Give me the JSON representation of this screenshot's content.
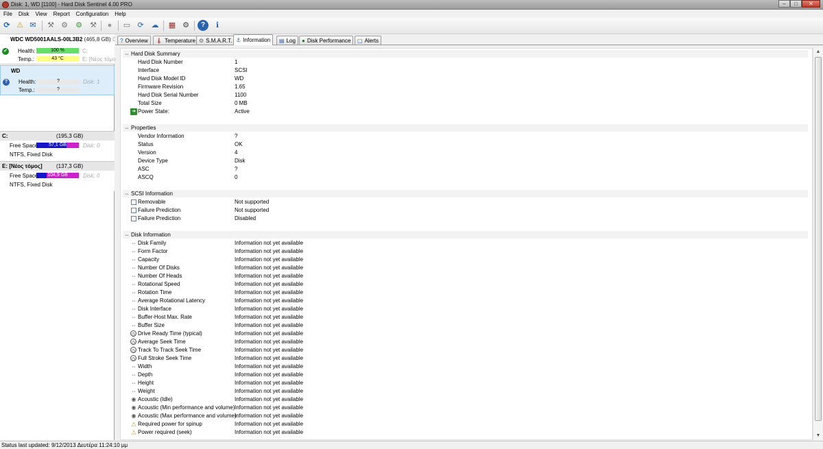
{
  "window": {
    "title": "Disk: 1, WD [1100]  -  Hard Disk Sentinel 4.00 PRO",
    "controls": {
      "minimize": "–",
      "maximize": "□",
      "close": "✕"
    }
  },
  "menu": [
    "File",
    "Disk",
    "View",
    "Report",
    "Configuration",
    "Help"
  ],
  "toolbar": {
    "icons": [
      "refresh-icon",
      "alert-icon",
      "mail-icon",
      "report-icon",
      "test-icon",
      "wrench-icon",
      "speed-icon",
      "short-test-icon",
      "disk-test-icon",
      "copy-icon",
      "clipboard-icon",
      "settings-icon",
      "hardware-icon",
      "help-icon",
      "info-icon"
    ],
    "glyphs": {
      "refresh": "⟳",
      "alert": "⚠",
      "mail": "✉",
      "t1": "⚒",
      "t2": "⚙",
      "t3": "⚙",
      "t4": "⚒",
      "t5": "●",
      "t6": "▭",
      "t7": "⟳",
      "t8": "☁",
      "t9": "▦",
      "t10": "⚙",
      "help": "?",
      "info": "ℹ"
    }
  },
  "disks": [
    {
      "name": "WDC WD5001AALS-00L3B2",
      "size": "(465,8 GB)",
      "extra": "Disk",
      "status": "✔",
      "health_label": "Health:",
      "health": "100 %",
      "health_pct": 100,
      "health_color": "#66dd66",
      "temp_label": "Temp.:",
      "temp": "43 °C",
      "temp_color": "#ffff88",
      "vol1": "C:",
      "vol2": "E: [Νέος τόμο"
    },
    {
      "name": "WD",
      "status": "?",
      "health_label": "Health:",
      "health": "?",
      "temp_label": "Temp.:",
      "temp": "?",
      "disk_ref": "Disk: 1"
    }
  ],
  "volumes": [
    {
      "letter": "C:",
      "size": "(195,3 GB)",
      "free_label": "Free Space",
      "free": "57,1 GB",
      "used_pct": 71,
      "disk_ref": "Disk: 0",
      "fs": "NTFS, Fixed Disk"
    },
    {
      "letter": "E: [Νέος τόμος]",
      "size": "(137,3 GB)",
      "free_label": "Free Space",
      "free": "104,9 GB",
      "used_pct": 24,
      "disk_ref": "Disk: 0",
      "fs": "NTFS, Fixed Disk"
    }
  ],
  "tabs": [
    {
      "label": "Overview",
      "icon": "?"
    },
    {
      "label": "Temperature",
      "icon": "🌡"
    },
    {
      "label": "S.M.A.R.T.",
      "icon": "⚙"
    },
    {
      "label": "Information",
      "icon": "⚓"
    },
    {
      "label": "Log",
      "icon": "▤"
    },
    {
      "label": "Disk Performance",
      "icon": "●"
    },
    {
      "label": "Alerts",
      "icon": "▢"
    }
  ],
  "sections": {
    "summary": {
      "title": "Hard Disk Summary",
      "rows": [
        {
          "label": "Hard Disk Number",
          "value": "1"
        },
        {
          "label": "Interface",
          "value": "SCSI"
        },
        {
          "label": "Hard Disk Model ID",
          "value": "WD"
        },
        {
          "label": "Firmware Revision",
          "value": "1.65"
        },
        {
          "label": "Hard Disk Serial Number",
          "value": "1100"
        },
        {
          "label": "Total Size",
          "value": "0 MB"
        },
        {
          "label": "Power State:",
          "value": "Active"
        }
      ]
    },
    "properties": {
      "title": "Properties",
      "rows": [
        {
          "label": "Vendor Information",
          "value": "?"
        },
        {
          "label": "Status",
          "value": "OK"
        },
        {
          "label": "Version",
          "value": "4"
        },
        {
          "label": "Device Type",
          "value": "Disk"
        },
        {
          "label": "ASC",
          "value": "?"
        },
        {
          "label": "ASCQ",
          "value": "0"
        }
      ]
    },
    "scsi": {
      "title": "SCSI Information",
      "rows": [
        {
          "label": "Removable",
          "value": "Not supported"
        },
        {
          "label": "Failure Prediction",
          "value": "Not supported"
        },
        {
          "label": "Failure Prediction",
          "value": "Disabled"
        }
      ]
    },
    "disk_info": {
      "title": "Disk Information",
      "na": "Information not yet available",
      "rows": [
        {
          "label": "Disk Family",
          "value": "Information not yet available"
        },
        {
          "label": "Form Factor",
          "value": "Information not yet available"
        },
        {
          "label": "Capacity",
          "value": "Information not yet available"
        },
        {
          "label": "Number Of Disks",
          "value": "Information not yet available"
        },
        {
          "label": "Number Of Heads",
          "value": "Information not yet available"
        },
        {
          "label": "Rotational Speed",
          "value": "Information not yet available"
        },
        {
          "label": "Rotation Time",
          "value": "Information not yet available"
        },
        {
          "label": "Average Rotational Latency",
          "value": "Information not yet available"
        },
        {
          "label": "Disk Interface",
          "value": "Information not yet available"
        },
        {
          "label": "Buffer-Host Max. Rate",
          "value": "Information not yet available"
        },
        {
          "label": "Buffer Size",
          "value": "Information not yet available"
        },
        {
          "label": "Drive Ready Time (typical)",
          "value": "Information not yet available"
        },
        {
          "label": "Average Seek Time",
          "value": "Information not yet available"
        },
        {
          "label": "Track To Track Seek Time",
          "value": "Information not yet available"
        },
        {
          "label": "Full Stroke Seek Time",
          "value": "Information not yet available"
        },
        {
          "label": "Width",
          "value": "Information not yet available"
        },
        {
          "label": "Depth",
          "value": "Information not yet available"
        },
        {
          "label": "Height",
          "value": "Information not yet available"
        },
        {
          "label": "Weight",
          "value": "Information not yet available"
        },
        {
          "label": "Acoustic (Idle)",
          "value": "Information not yet available"
        },
        {
          "label": "Acoustic (Min performance and volume)",
          "value": "Information not yet available"
        },
        {
          "label": "Acoustic (Max performance and volume)",
          "value": "Information not yet available"
        },
        {
          "label": "Required power for spinup",
          "value": "Information not yet available"
        },
        {
          "label": "Power required (seek)",
          "value": "Information not yet available"
        }
      ]
    }
  },
  "status_bar": "Status last updated: 9/12/2013 Δευτέρα 11:24:10 μμ",
  "colors": {
    "free_bar": "#cc22cc",
    "used_bar": "#1515cc",
    "selected_card": "#ddeefa",
    "ok": "#1f8a1f",
    "unknown": "#2c5fb3"
  }
}
